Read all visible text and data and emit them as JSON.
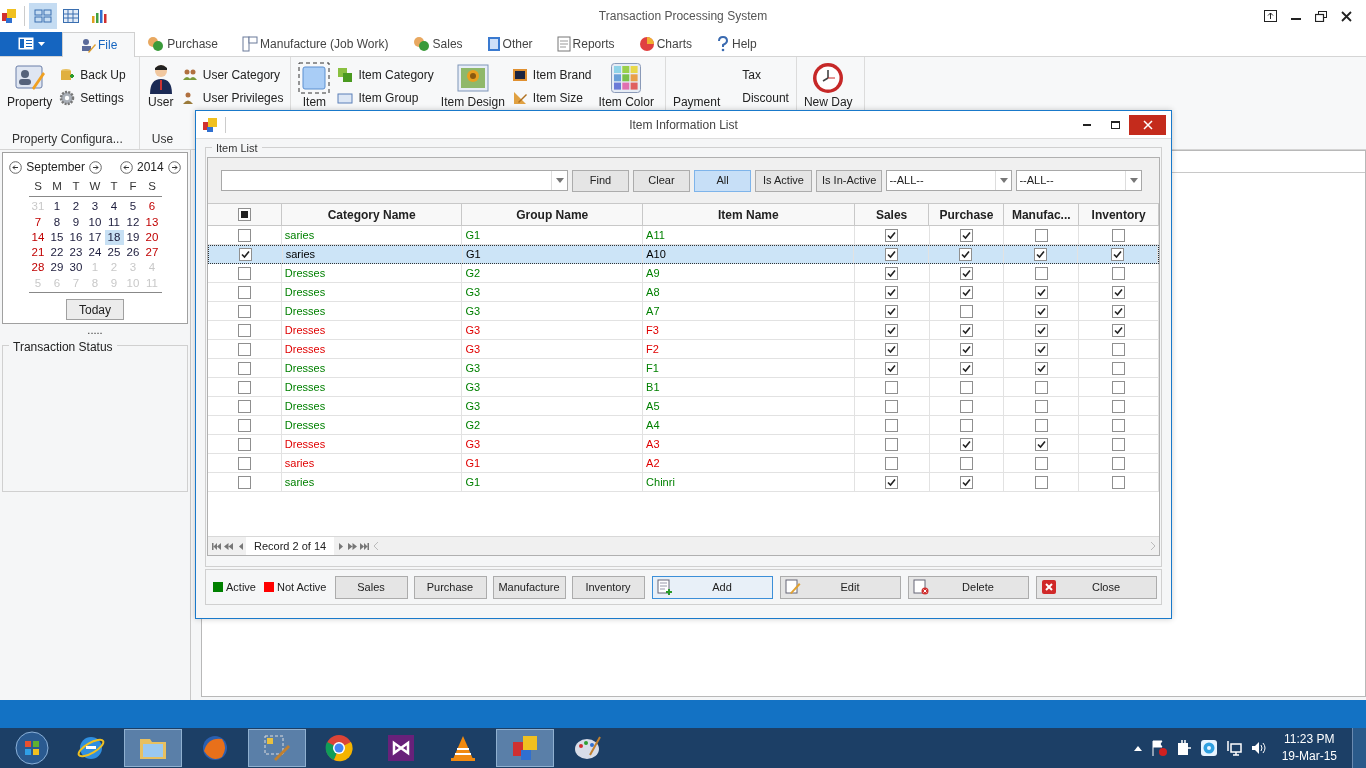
{
  "title_bar": {
    "title": "Transaction Processing System",
    "quick_access": [
      {
        "kind": "tiles",
        "selected": true
      },
      {
        "kind": "grid",
        "selected": false
      },
      {
        "kind": "chart",
        "selected": false
      }
    ]
  },
  "ribbon": {
    "tabs": [
      {
        "label": "File",
        "selected": true
      },
      {
        "label": "Purchase",
        "selected": false
      },
      {
        "label": "Manufacture (Job Work)",
        "selected": false
      },
      {
        "label": "Sales",
        "selected": false
      },
      {
        "label": "Other",
        "selected": false
      },
      {
        "label": "Reports",
        "selected": false
      },
      {
        "label": "Charts",
        "selected": false
      },
      {
        "label": "Help",
        "selected": false
      }
    ],
    "groups": [
      {
        "label": "Property Configura...",
        "columns": [
          {
            "kind": "large",
            "label": "Property"
          },
          {
            "kind": "stack",
            "items": [
              {
                "label": "Back Up"
              },
              {
                "label": "Settings"
              }
            ]
          }
        ]
      },
      {
        "label": "Use",
        "columns": [
          {
            "kind": "large",
            "label": "User"
          },
          {
            "kind": "stack",
            "items": [
              {
                "label": "User Category"
              },
              {
                "label": "User Privileges"
              }
            ]
          }
        ]
      },
      {
        "columns": [
          {
            "kind": "large",
            "label": "Item"
          },
          {
            "kind": "stack",
            "items": [
              {
                "label": "Item Category"
              },
              {
                "label": "Item Group"
              }
            ]
          },
          {
            "kind": "large",
            "label": "Item Design"
          },
          {
            "kind": "stack",
            "items": [
              {
                "label": "Item Brand"
              },
              {
                "label": "Item Size"
              }
            ]
          },
          {
            "kind": "large",
            "label": "Item Color"
          }
        ]
      },
      {
        "columns": [
          {
            "kind": "large",
            "label": "Payment"
          },
          {
            "kind": "stack",
            "items": [
              {
                "label": "Tax"
              },
              {
                "label": "Discount"
              }
            ]
          }
        ]
      },
      {
        "columns": [
          {
            "kind": "large",
            "label": "New Day"
          }
        ]
      }
    ]
  },
  "calendar": {
    "month": "September",
    "year": "2014",
    "weekdays": [
      "S",
      "M",
      "T",
      "W",
      "T",
      "F",
      "S"
    ],
    "days": [
      {
        "text": "31",
        "other_month": true,
        "selected": false
      },
      {
        "text": "1",
        "other_month": false,
        "selected": false
      },
      {
        "text": "2",
        "other_month": false,
        "selected": false
      },
      {
        "text": "3",
        "other_month": false,
        "selected": false
      },
      {
        "text": "4",
        "other_month": false,
        "selected": false
      },
      {
        "text": "5",
        "other_month": false,
        "selected": false
      },
      {
        "text": "6",
        "other_month": false,
        "selected": false
      },
      {
        "text": "7",
        "other_month": false,
        "selected": false
      },
      {
        "text": "8",
        "other_month": false,
        "selected": false
      },
      {
        "text": "9",
        "other_month": false,
        "selected": false
      },
      {
        "text": "10",
        "other_month": false,
        "selected": false
      },
      {
        "text": "11",
        "other_month": false,
        "selected": false
      },
      {
        "text": "12",
        "other_month": false,
        "selected": false
      },
      {
        "text": "13",
        "other_month": false,
        "selected": false
      },
      {
        "text": "14",
        "other_month": false,
        "selected": false
      },
      {
        "text": "15",
        "other_month": false,
        "selected": false
      },
      {
        "text": "16",
        "other_month": false,
        "selected": false
      },
      {
        "text": "17",
        "other_month": false,
        "selected": false
      },
      {
        "text": "18",
        "other_month": false,
        "selected": true
      },
      {
        "text": "19",
        "other_month": false,
        "selected": false
      },
      {
        "text": "20",
        "other_month": false,
        "selected": false
      },
      {
        "text": "21",
        "other_month": false,
        "selected": false
      },
      {
        "text": "22",
        "other_month": false,
        "selected": false
      },
      {
        "text": "23",
        "other_month": false,
        "selected": false
      },
      {
        "text": "24",
        "other_month": false,
        "selected": false
      },
      {
        "text": "25",
        "other_month": false,
        "selected": false
      },
      {
        "text": "26",
        "other_month": false,
        "selected": false
      },
      {
        "text": "27",
        "other_month": false,
        "selected": false
      },
      {
        "text": "28",
        "other_month": false,
        "selected": false
      },
      {
        "text": "29",
        "other_month": false,
        "selected": false
      },
      {
        "text": "30",
        "other_month": false,
        "selected": false
      },
      {
        "text": "1",
        "other_month": true,
        "selected": false
      },
      {
        "text": "2",
        "other_month": true,
        "selected": false
      },
      {
        "text": "3",
        "other_month": true,
        "selected": false
      },
      {
        "text": "4",
        "other_month": true,
        "selected": false
      },
      {
        "text": "5",
        "other_month": true,
        "selected": false
      },
      {
        "text": "6",
        "other_month": true,
        "selected": false
      },
      {
        "text": "7",
        "other_month": true,
        "selected": false
      },
      {
        "text": "8",
        "other_month": true,
        "selected": false
      },
      {
        "text": "9",
        "other_month": true,
        "selected": false
      },
      {
        "text": "10",
        "other_month": true,
        "selected": false
      },
      {
        "text": "11",
        "other_month": true,
        "selected": false
      }
    ],
    "today_button": "Today"
  },
  "splitter": ".....",
  "transaction_status": {
    "title": "Transaction Status"
  },
  "dialog": {
    "title": "Item Information List",
    "group_title": "Item List",
    "filter": {
      "buttons": [
        {
          "label": "Find",
          "selected": false
        },
        {
          "label": "Clear",
          "selected": false
        },
        {
          "label": "All",
          "selected": true
        },
        {
          "label": "Is Active",
          "selected": false
        },
        {
          "label": "Is In-Active",
          "selected": false
        }
      ],
      "combos": [
        "--ALL--",
        "--ALL--"
      ]
    },
    "select_all": {
      "partial": true
    },
    "columns": [
      "Category Name",
      "Group Name",
      "Item Name",
      "Sales",
      "Purchase",
      "Manufac...",
      "Inventory"
    ],
    "rows": [
      {
        "checked": false,
        "selected": false,
        "active": true,
        "category": "saries",
        "group": "G1",
        "item": "A11",
        "sales": true,
        "purchase": true,
        "manufacture": false,
        "inventory": false
      },
      {
        "checked": true,
        "selected": true,
        "category": "saries",
        "group": "G1",
        "item": "A10",
        "sales": true,
        "purchase": true,
        "manufacture": true,
        "inventory": true
      },
      {
        "checked": false,
        "selected": false,
        "active": true,
        "category": "Dresses",
        "group": "G2",
        "item": "A9",
        "sales": true,
        "purchase": true,
        "manufacture": false,
        "inventory": false
      },
      {
        "checked": false,
        "selected": false,
        "active": true,
        "category": "Dresses",
        "group": "G3",
        "item": "A8",
        "sales": true,
        "purchase": true,
        "manufacture": true,
        "inventory": true
      },
      {
        "checked": false,
        "selected": false,
        "active": true,
        "category": "Dresses",
        "group": "G3",
        "item": "A7",
        "sales": true,
        "purchase": false,
        "manufacture": true,
        "inventory": true
      },
      {
        "checked": false,
        "selected": false,
        "active": false,
        "category": "Dresses",
        "group": "G3",
        "item": "F3",
        "sales": true,
        "purchase": true,
        "manufacture": true,
        "inventory": true
      },
      {
        "checked": false,
        "selected": false,
        "active": false,
        "category": "Dresses",
        "group": "G3",
        "item": "F2",
        "sales": true,
        "purchase": true,
        "manufacture": true,
        "inventory": false
      },
      {
        "checked": false,
        "selected": false,
        "active": true,
        "category": "Dresses",
        "group": "G3",
        "item": "F1",
        "sales": true,
        "purchase": true,
        "manufacture": true,
        "inventory": false
      },
      {
        "checked": false,
        "selected": false,
        "active": true,
        "category": "Dresses",
        "group": "G3",
        "item": "B1",
        "sales": false,
        "purchase": false,
        "manufacture": false,
        "inventory": false
      },
      {
        "checked": false,
        "selected": false,
        "active": true,
        "category": "Dresses",
        "group": "G3",
        "item": "A5",
        "sales": false,
        "purchase": false,
        "manufacture": false,
        "inventory": false
      },
      {
        "checked": false,
        "selected": false,
        "active": true,
        "category": "Dresses",
        "group": "G2",
        "item": "A4",
        "sales": false,
        "purchase": false,
        "manufacture": false,
        "inventory": false
      },
      {
        "checked": false,
        "selected": false,
        "active": false,
        "category": "Dresses",
        "group": "G3",
        "item": "A3",
        "sales": false,
        "purchase": true,
        "manufacture": true,
        "inventory": false
      },
      {
        "checked": false,
        "selected": false,
        "active": false,
        "category": "saries",
        "group": "G1",
        "item": "A2",
        "sales": false,
        "purchase": false,
        "manufacture": false,
        "inventory": false
      },
      {
        "checked": false,
        "selected": false,
        "active": true,
        "category": "saries",
        "group": "G1",
        "item": "Chinri",
        "sales": true,
        "purchase": true,
        "manufacture": false,
        "inventory": false
      }
    ],
    "record_text": "Record 2 of 14",
    "legend": [
      {
        "label": "Active",
        "color": "#008000"
      },
      {
        "label": "Not Active",
        "color": "#ff0000"
      }
    ],
    "buttons": [
      {
        "label": "Sales",
        "kind": "plain"
      },
      {
        "label": "Purchase",
        "kind": "plain"
      },
      {
        "label": "Manufacture",
        "kind": "plain"
      },
      {
        "label": "Inventory",
        "kind": "plain"
      },
      {
        "label": "Add",
        "kind": "add"
      },
      {
        "label": "Edit",
        "kind": "edit"
      },
      {
        "label": "Delete",
        "kind": "delete"
      },
      {
        "label": "Close",
        "kind": "close"
      }
    ]
  },
  "taskbar": {
    "time": "11:23 PM",
    "date": "19-Mar-15"
  }
}
